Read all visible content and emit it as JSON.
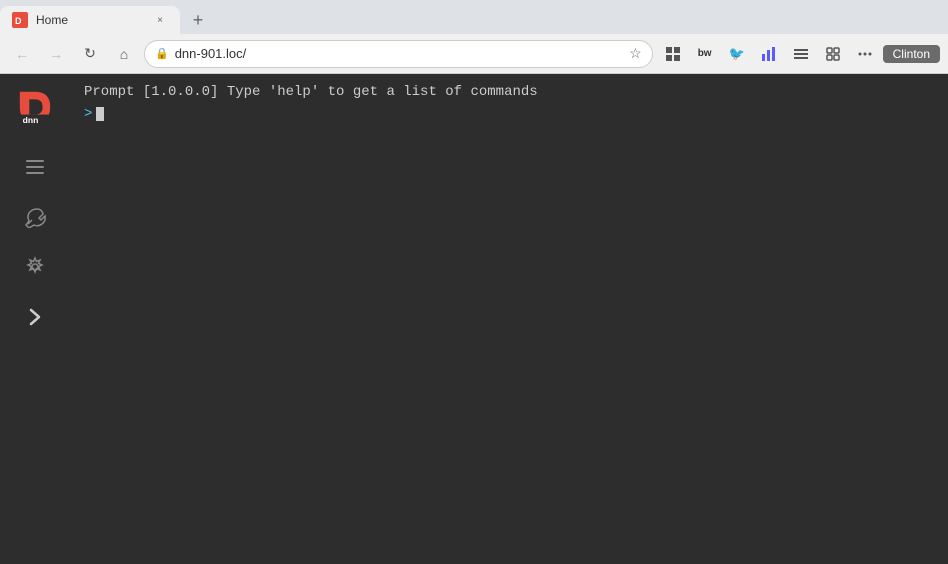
{
  "browser": {
    "tab": {
      "title": "Home",
      "close_label": "×"
    },
    "nav": {
      "back_label": "←",
      "forward_label": "→",
      "refresh_label": "↻",
      "home_label": "⌂",
      "url": "dnn-901.loc/",
      "star_label": "☆"
    },
    "toolbar": {
      "icon1": "▦",
      "icon2": "bw",
      "icon3": "🐦",
      "icon4": "📊",
      "icon5": "≡",
      "icon6": "☰",
      "icon7": "⊞",
      "user": "Clinton"
    }
  },
  "sidebar": {
    "items": [
      {
        "name": "menu-icon",
        "label": "≡"
      },
      {
        "name": "tools-icon",
        "label": "✕"
      },
      {
        "name": "settings-icon",
        "label": "⚙"
      },
      {
        "name": "expand-icon",
        "label": "›"
      }
    ]
  },
  "terminal": {
    "prompt_line": "Prompt [1.0.0.0] Type 'help' to get a list of commands",
    "cursor_symbol": ">"
  }
}
